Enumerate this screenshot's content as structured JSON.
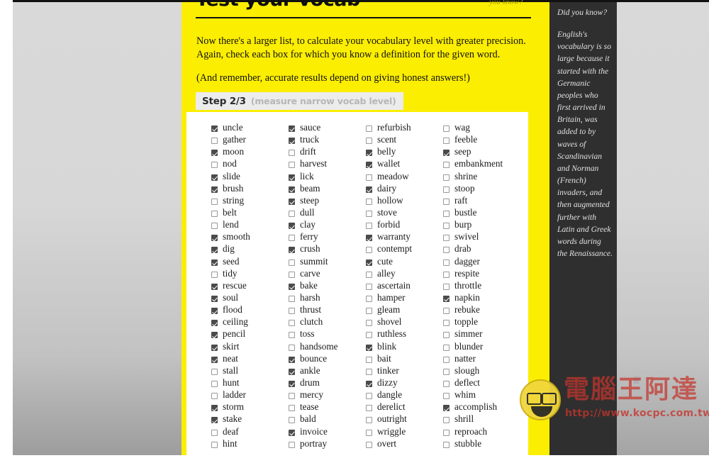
{
  "page": {
    "site_title": "Test your vocab",
    "nav_link": "you know?",
    "background_color": "#fcee00",
    "card_color": "#ffffff",
    "sidebar_color": "#2f2f2f",
    "gutter_color": "#d9d9d9"
  },
  "intro": {
    "paragraph1": "Now there's a larger list, to calculate your vocabulary level with greater precision. Again, check each box for which you know a definition for the given word.",
    "paragraph2": "(And remember, accurate results depend on giving honest answers!)"
  },
  "step": {
    "number": "Step 2/3",
    "description": "(measure narrow vocab level)"
  },
  "sidebar": {
    "heading": "Did you know?",
    "body": "English's vocabulary is so large because it started with the Germanic peoples who first arrived in Britain, was added to by waves of Scandinavian and Norman (French) invaders, and then augmented further with Latin and Greek words during the Renaissance."
  },
  "word_columns": [
    {
      "column_index": 1,
      "words": [
        {
          "label": "uncle",
          "checked": true
        },
        {
          "label": "gather",
          "checked": false
        },
        {
          "label": "moon",
          "checked": true
        },
        {
          "label": "nod",
          "checked": false
        },
        {
          "label": "slide",
          "checked": true
        },
        {
          "label": "brush",
          "checked": true
        },
        {
          "label": "string",
          "checked": false
        },
        {
          "label": "belt",
          "checked": false
        },
        {
          "label": "lend",
          "checked": false
        },
        {
          "label": "smooth",
          "checked": true
        },
        {
          "label": "dig",
          "checked": true
        },
        {
          "label": "seed",
          "checked": true
        },
        {
          "label": "tidy",
          "checked": false
        },
        {
          "label": "rescue",
          "checked": true
        },
        {
          "label": "soul",
          "checked": true
        },
        {
          "label": "flood",
          "checked": true
        },
        {
          "label": "ceiling",
          "checked": true
        },
        {
          "label": "pencil",
          "checked": true
        },
        {
          "label": "skirt",
          "checked": true
        },
        {
          "label": "neat",
          "checked": true
        },
        {
          "label": "stall",
          "checked": false
        },
        {
          "label": "hunt",
          "checked": false
        },
        {
          "label": "ladder",
          "checked": false
        },
        {
          "label": "storm",
          "checked": true
        },
        {
          "label": "stake",
          "checked": true
        },
        {
          "label": "deaf",
          "checked": false
        },
        {
          "label": "hint",
          "checked": false
        }
      ]
    },
    {
      "column_index": 2,
      "words": [
        {
          "label": "sauce",
          "checked": true
        },
        {
          "label": "truck",
          "checked": true
        },
        {
          "label": "drift",
          "checked": false
        },
        {
          "label": "harvest",
          "checked": false
        },
        {
          "label": "lick",
          "checked": true
        },
        {
          "label": "beam",
          "checked": true
        },
        {
          "label": "steep",
          "checked": true
        },
        {
          "label": "dull",
          "checked": false
        },
        {
          "label": "clay",
          "checked": true
        },
        {
          "label": "ferry",
          "checked": false
        },
        {
          "label": "crush",
          "checked": true
        },
        {
          "label": "summit",
          "checked": false
        },
        {
          "label": "carve",
          "checked": false
        },
        {
          "label": "bake",
          "checked": true
        },
        {
          "label": "harsh",
          "checked": false
        },
        {
          "label": "thrust",
          "checked": false
        },
        {
          "label": "clutch",
          "checked": false
        },
        {
          "label": "toss",
          "checked": false
        },
        {
          "label": "handsome",
          "checked": false
        },
        {
          "label": "bounce",
          "checked": true
        },
        {
          "label": "ankle",
          "checked": true
        },
        {
          "label": "drum",
          "checked": true
        },
        {
          "label": "mercy",
          "checked": false
        },
        {
          "label": "tease",
          "checked": false
        },
        {
          "label": "bald",
          "checked": false
        },
        {
          "label": "invoice",
          "checked": true
        },
        {
          "label": "portray",
          "checked": false
        }
      ]
    },
    {
      "column_index": 3,
      "words": [
        {
          "label": "refurbish",
          "checked": false
        },
        {
          "label": "scent",
          "checked": false
        },
        {
          "label": "belly",
          "checked": true
        },
        {
          "label": "wallet",
          "checked": true
        },
        {
          "label": "meadow",
          "checked": false
        },
        {
          "label": "dairy",
          "checked": true
        },
        {
          "label": "hollow",
          "checked": false
        },
        {
          "label": "stove",
          "checked": false
        },
        {
          "label": "forbid",
          "checked": false
        },
        {
          "label": "warranty",
          "checked": true
        },
        {
          "label": "contempt",
          "checked": false
        },
        {
          "label": "cute",
          "checked": true
        },
        {
          "label": "alley",
          "checked": false
        },
        {
          "label": "ascertain",
          "checked": false
        },
        {
          "label": "hamper",
          "checked": false
        },
        {
          "label": "gleam",
          "checked": false
        },
        {
          "label": "shovel",
          "checked": false
        },
        {
          "label": "ruthless",
          "checked": false
        },
        {
          "label": "blink",
          "checked": true
        },
        {
          "label": "bait",
          "checked": false
        },
        {
          "label": "tinker",
          "checked": false
        },
        {
          "label": "dizzy",
          "checked": true
        },
        {
          "label": "dangle",
          "checked": false
        },
        {
          "label": "derelict",
          "checked": false
        },
        {
          "label": "outright",
          "checked": false
        },
        {
          "label": "wriggle",
          "checked": false
        },
        {
          "label": "overt",
          "checked": false
        }
      ]
    },
    {
      "column_index": 4,
      "words": [
        {
          "label": "wag",
          "checked": false
        },
        {
          "label": "feeble",
          "checked": false
        },
        {
          "label": "seep",
          "checked": true
        },
        {
          "label": "embankment",
          "checked": false
        },
        {
          "label": "shrine",
          "checked": false
        },
        {
          "label": "stoop",
          "checked": false
        },
        {
          "label": "raft",
          "checked": false
        },
        {
          "label": "bustle",
          "checked": false
        },
        {
          "label": "burp",
          "checked": false
        },
        {
          "label": "swivel",
          "checked": false
        },
        {
          "label": "drab",
          "checked": false
        },
        {
          "label": "dagger",
          "checked": false
        },
        {
          "label": "respite",
          "checked": false
        },
        {
          "label": "throttle",
          "checked": false
        },
        {
          "label": "napkin",
          "checked": true
        },
        {
          "label": "rebuke",
          "checked": false
        },
        {
          "label": "topple",
          "checked": false
        },
        {
          "label": "simmer",
          "checked": false
        },
        {
          "label": "blunder",
          "checked": false
        },
        {
          "label": "natter",
          "checked": false
        },
        {
          "label": "slough",
          "checked": false
        },
        {
          "label": "deflect",
          "checked": false
        },
        {
          "label": "whim",
          "checked": false
        },
        {
          "label": "accomplish",
          "checked": true
        },
        {
          "label": "shrill",
          "checked": false
        },
        {
          "label": "reproach",
          "checked": false
        },
        {
          "label": "stubble",
          "checked": false
        }
      ]
    }
  ],
  "watermark": {
    "brand": "電腦王阿達",
    "url": "http://www.kocpc.com.tw"
  }
}
